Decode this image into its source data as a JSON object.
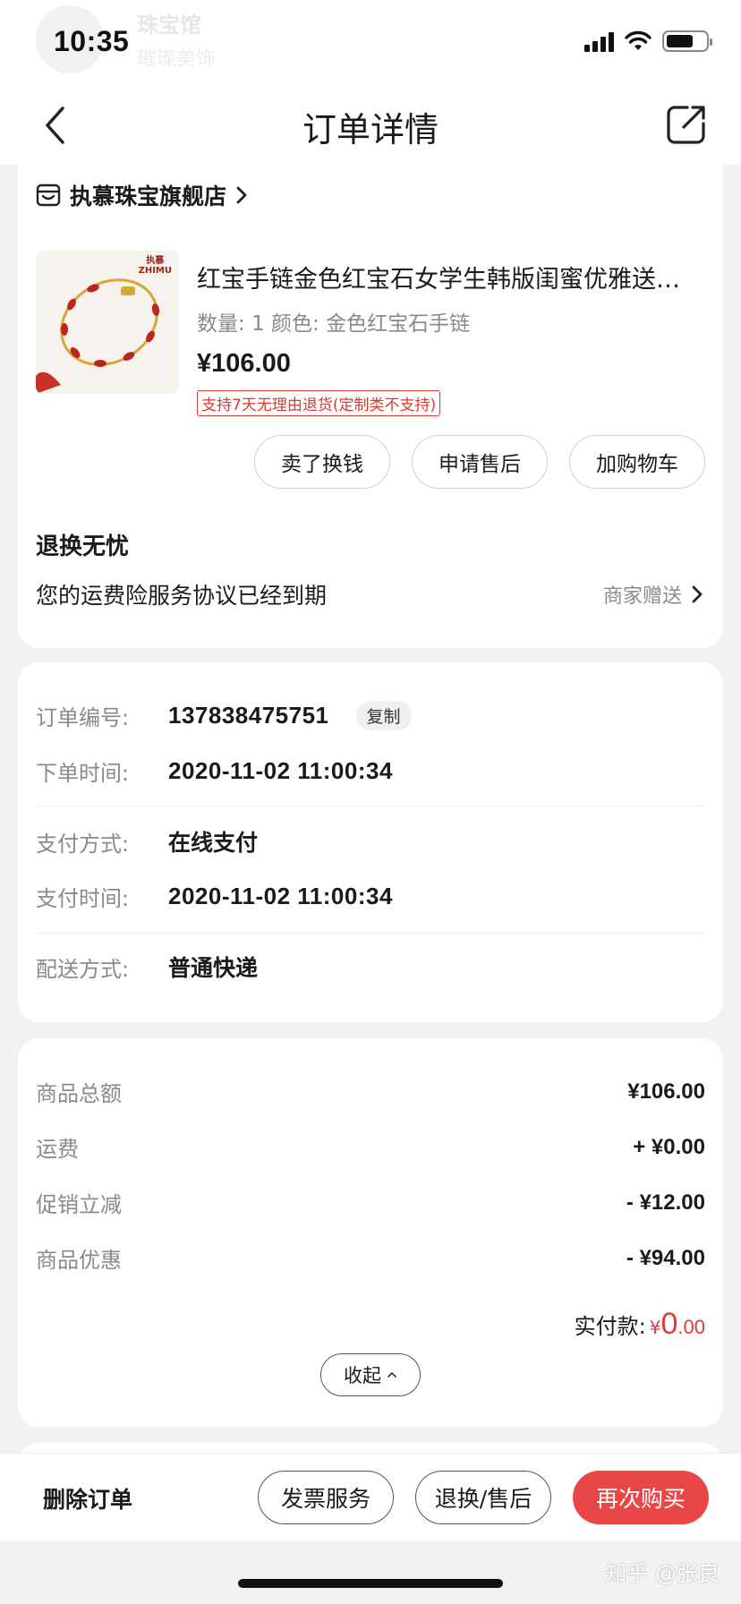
{
  "status_bar": {
    "time": "10:35"
  },
  "ghost_header": {
    "title": "珠宝馆",
    "subtitle": "璀璨美饰"
  },
  "nav": {
    "title": "订单详情"
  },
  "shop": {
    "name": "执慕珠宝旗舰店"
  },
  "product": {
    "image_brand_line1": "执慕",
    "image_brand_line2": "ZHIMU",
    "title": "红宝手链金色红宝石女学生韩版闺蜜优雅送女友礼物",
    "spec": "数量: 1  颜色: 金色红宝石手链",
    "price": "¥106.00",
    "tag": "支持7天无理由退货(定制类不支持)"
  },
  "product_actions": {
    "sell": "卖了换钱",
    "after_sale": "申请售后",
    "add_cart": "加购物车"
  },
  "worry_free": {
    "title": "退换无忧",
    "desc": "您的运费险服务协议已经到期",
    "gift": "商家赠送"
  },
  "order_info": {
    "order_no_label": "订单编号:",
    "order_no": "137838475751",
    "copy": "复制",
    "order_time_label": "下单时间:",
    "order_time": "2020-11-02 11:00:34",
    "pay_method_label": "支付方式:",
    "pay_method": "在线支付",
    "pay_time_label": "支付时间:",
    "pay_time": "2020-11-02 11:00:34",
    "delivery_label": "配送方式:",
    "delivery": "普通快递"
  },
  "summary": {
    "rows": [
      {
        "label": "商品总额",
        "value": "¥106.00"
      },
      {
        "label": "运费",
        "value": "+ ¥0.00"
      },
      {
        "label": "促销立减",
        "value": "- ¥12.00"
      },
      {
        "label": "商品优惠",
        "value": "- ¥94.00"
      }
    ],
    "paid_label": "实付款:",
    "paid_currency": "¥",
    "paid_int": "0",
    "paid_dec": ".00",
    "collapse": "收起"
  },
  "bottom_bar": {
    "delete": "删除订单",
    "invoice": "发票服务",
    "return": "退换/售后",
    "buy_again": "再次购买"
  },
  "watermark": "知乎 @张良",
  "colors": {
    "accent": "#e94747",
    "price_red": "#e53935",
    "tag_red": "#d9392e",
    "muted": "#8a8a8a"
  }
}
